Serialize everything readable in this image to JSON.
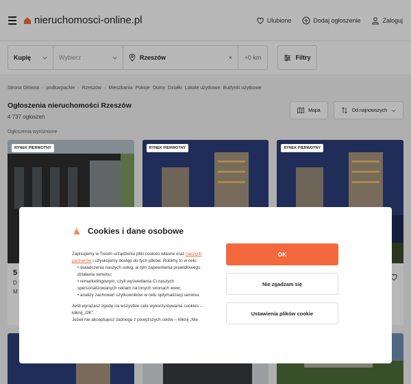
{
  "header": {
    "site_name": "nieruchomosci-online.pl",
    "favorites": "Ulubione",
    "add_listing": "Dodaj ogłoszenie",
    "login": "Zaloguj"
  },
  "search": {
    "transaction": "Kupię",
    "type_placeholder": "Wybierz",
    "location": "Rzeszów",
    "radius": "+0 km",
    "filters": "Filtry"
  },
  "breadcrumb": [
    "Strona Główna",
    "podkarpackie",
    "Rzeszów",
    "Mieszkania",
    "Pokoje",
    "Domy",
    "Działki",
    "Lokale użytkowe",
    "Budynki użytkowe"
  ],
  "page": {
    "title": "Ogłoszenia nieruchomości Rzeszów",
    "count": "4 737 ogłoszeń",
    "map_label": "Mapa",
    "sort_label": "Od najnowszych",
    "featured": "Ogłoszenia wyróżnione"
  },
  "cards": [
    {
      "badge": "RYNEK PIERWOTNY",
      "price": "5",
      "sub": "D",
      "sub2": "M"
    },
    {
      "badge": "RYNEK PIERWOTNY",
      "price": "",
      "sub": "",
      "sub2": ""
    },
    {
      "badge": "RYNEK PIERWOTNY",
      "price": "",
      "sub": "",
      "sub2": ""
    }
  ],
  "modal": {
    "title": "Cookies i dane osobowe",
    "intro_pre": "Zapisujemy w Twoim urządzeniu pliki cookies własne oraz ",
    "intro_link": "naszych partnerów",
    "intro_post": " i uzyskujemy dostęp do tych plików. Robimy to w celu:",
    "purposes": [
      "świadczenia naszych usług, w tym zapewnienia prawidłowego działania serwisu;",
      "remarketingowym, czyli wyświetlania Ci naszych spersonalizowanych reklam na innych stronach www;",
      "analizy zachowań użytkowników w celu optymalizacji serwisu."
    ],
    "consent_text": "Jeśli wyrażasz zgodę na wszystkie cele wykorzystywania cookies – kliknij „OK”.",
    "reject_text": "Jeżeli nie akceptujesz żadnego z powyższych celów – kliknij „Nie",
    "ok_label": "OK",
    "reject_label": "Nie zgadzam się",
    "settings_label": "Ustawienia plików cookie"
  },
  "colors": {
    "accent": "#f4683e",
    "link": "#e8643c"
  }
}
